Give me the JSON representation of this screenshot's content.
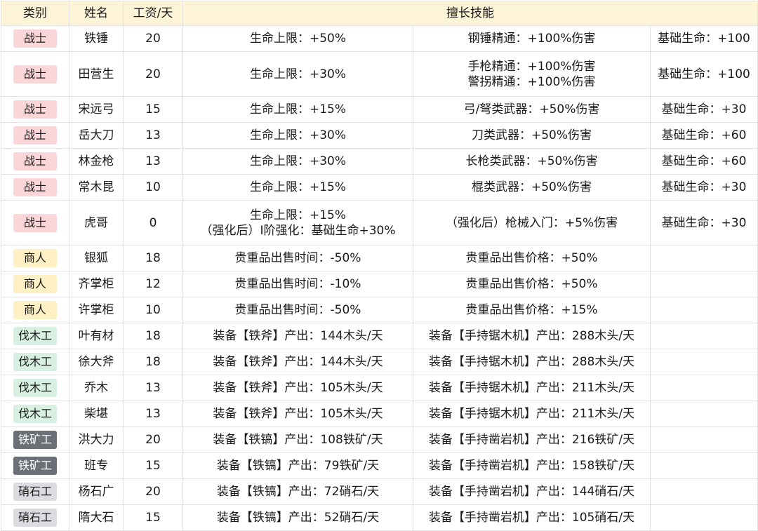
{
  "header": {
    "category": "类别",
    "name": "姓名",
    "wage": "工资/天",
    "skills": "擅长技能"
  },
  "category_colors": {
    "战士": {
      "bg": "#fbd6d9",
      "fg": "#1a1a1a"
    },
    "商人": {
      "bg": "#fdf0c4",
      "fg": "#1a1a1a"
    },
    "伐木工": {
      "bg": "#d8f0e2",
      "fg": "#1a1a1a"
    },
    "铁矿工": {
      "bg": "#6b6f76",
      "fg": "#ffffff"
    },
    "硝石工": {
      "bg": "#dadcdf",
      "fg": "#1a1a1a"
    }
  },
  "rows": [
    {
      "category": "战士",
      "name": "铁锤",
      "wage": "20",
      "skill1": [
        "生命上限：+50%"
      ],
      "skill2": [
        "钢锤精通：+100%伤害"
      ],
      "skill3": "基础生命：+100"
    },
    {
      "category": "战士",
      "name": "田营生",
      "wage": "20",
      "skill1": [
        "生命上限：+30%"
      ],
      "skill2": [
        "手枪精通：+100%伤害",
        "警拐精通：+100%伤害"
      ],
      "skill3": "基础生命：+100"
    },
    {
      "category": "战士",
      "name": "宋远弓",
      "wage": "15",
      "skill1": [
        "生命上限：+15%"
      ],
      "skill2": [
        "弓/弩类武器：+50%伤害"
      ],
      "skill3": "基础生命：+30"
    },
    {
      "category": "战士",
      "name": "岳大刀",
      "wage": "13",
      "skill1": [
        "生命上限：+30%"
      ],
      "skill2": [
        "刀类武器：+50%伤害"
      ],
      "skill3": "基础生命：+60"
    },
    {
      "category": "战士",
      "name": "林金枪",
      "wage": "13",
      "skill1": [
        "生命上限：+30%"
      ],
      "skill2": [
        "长枪类武器：+50%伤害"
      ],
      "skill3": "基础生命：+60"
    },
    {
      "category": "战士",
      "name": "常木昆",
      "wage": "10",
      "skill1": [
        "生命上限：+15%"
      ],
      "skill2": [
        "棍类武器：+50%伤害"
      ],
      "skill3": "基础生命：+30"
    },
    {
      "category": "战士",
      "name": "虎哥",
      "wage": "0",
      "skill1": [
        "生命上限：+15%",
        "（强化后）Ⅰ阶强化：基础生命+30%"
      ],
      "skill2": [
        "（强化后）枪械入门：+5%伤害"
      ],
      "skill3": "基础生命：+30"
    },
    {
      "category": "商人",
      "name": "银狐",
      "wage": "18",
      "skill1": [
        "贵重品出售时间：-50%"
      ],
      "skill2": [
        "贵重品出售价格：+50%"
      ],
      "skill3": ""
    },
    {
      "category": "商人",
      "name": "齐掌柜",
      "wage": "12",
      "skill1": [
        "贵重品出售时间：-10%"
      ],
      "skill2": [
        "贵重品出售价格：+50%"
      ],
      "skill3": ""
    },
    {
      "category": "商人",
      "name": "许掌柜",
      "wage": "10",
      "skill1": [
        "贵重品出售时间：-50%"
      ],
      "skill2": [
        "贵重品出售价格：+15%"
      ],
      "skill3": ""
    },
    {
      "category": "伐木工",
      "name": "叶有材",
      "wage": "18",
      "skill1": [
        "装备【铁斧】产出：144木头/天"
      ],
      "skill2": [
        "装备【手持锯木机】产出：288木头/天"
      ],
      "skill3": ""
    },
    {
      "category": "伐木工",
      "name": "徐大斧",
      "wage": "18",
      "skill1": [
        "装备【铁斧】产出：144木头/天"
      ],
      "skill2": [
        "装备【手持锯木机】产出：288木头/天"
      ],
      "skill3": ""
    },
    {
      "category": "伐木工",
      "name": "乔木",
      "wage": "13",
      "skill1": [
        "装备【铁斧】产出：105木头/天"
      ],
      "skill2": [
        "装备【手持锯木机】产出：211木头/天"
      ],
      "skill3": ""
    },
    {
      "category": "伐木工",
      "name": "柴堪",
      "wage": "13",
      "skill1": [
        "装备【铁斧】产出：105木头/天"
      ],
      "skill2": [
        "装备【手持锯木机】产出：211木头/天"
      ],
      "skill3": ""
    },
    {
      "category": "铁矿工",
      "name": "洪大力",
      "wage": "20",
      "skill1": [
        "装备【铁镐】产出：108铁矿/天"
      ],
      "skill2": [
        "装备【手持凿岩机】产出：216铁矿/天"
      ],
      "skill3": ""
    },
    {
      "category": "铁矿工",
      "name": "班专",
      "wage": "15",
      "skill1": [
        "装备【铁镐】产出：79铁矿/天"
      ],
      "skill2": [
        "装备【手持凿岩机】产出：158铁矿/天"
      ],
      "skill3": ""
    },
    {
      "category": "硝石工",
      "name": "杨石广",
      "wage": "20",
      "skill1": [
        "装备【铁镐】产出：72硝石/天"
      ],
      "skill2": [
        "装备【手持凿岩机】产出：144硝石/天"
      ],
      "skill3": ""
    },
    {
      "category": "硝石工",
      "name": "隋大石",
      "wage": "15",
      "skill1": [
        "装备【铁镐】产出：52硝石/天"
      ],
      "skill2": [
        "装备【手持凿岩机】产出：105硝石/天"
      ],
      "skill3": ""
    }
  ]
}
